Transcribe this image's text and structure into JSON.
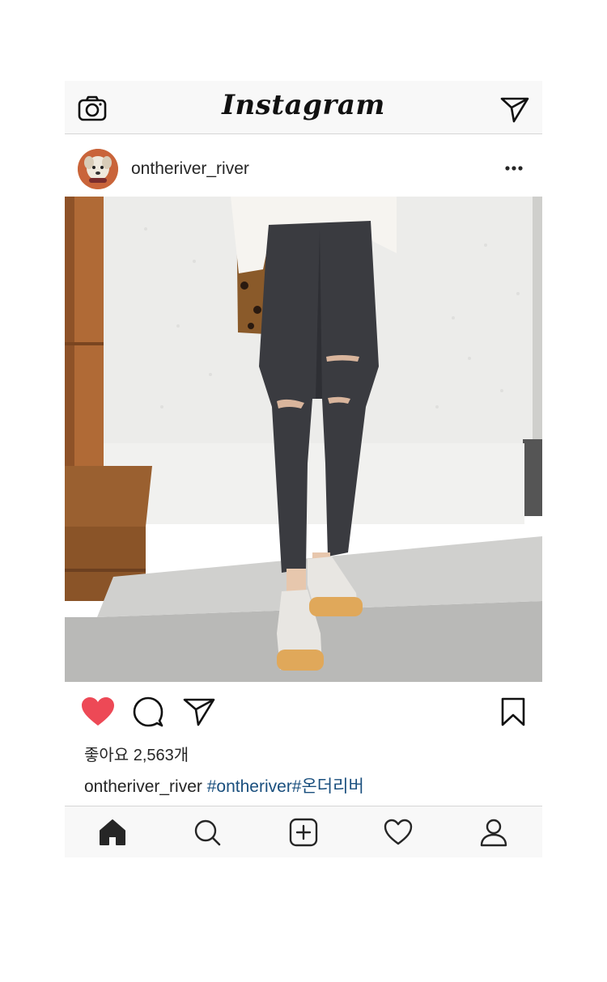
{
  "topbar": {
    "logo_text": "Instagram",
    "left_icon": "camera-icon",
    "right_icon": "direct-message-icon"
  },
  "post": {
    "username": "ontheriver_river",
    "menu_icon": "more-options-icon",
    "image_description_icon": "post-photo",
    "likes_text": "좋아요 2,563개",
    "caption_user": "ontheriver_river",
    "caption_tags": "#ontheriver#온더리버",
    "liked": true,
    "like_color": "#ed4956"
  },
  "actions": {
    "like_icon": "heart-icon",
    "comment_icon": "comment-icon",
    "share_icon": "share-icon",
    "save_icon": "bookmark-icon"
  },
  "bottomnav": {
    "items": [
      {
        "icon": "home-icon",
        "active": true
      },
      {
        "icon": "search-icon",
        "active": false
      },
      {
        "icon": "add-post-icon",
        "active": false
      },
      {
        "icon": "activity-heart-icon",
        "active": false
      },
      {
        "icon": "profile-icon",
        "active": false
      }
    ]
  }
}
